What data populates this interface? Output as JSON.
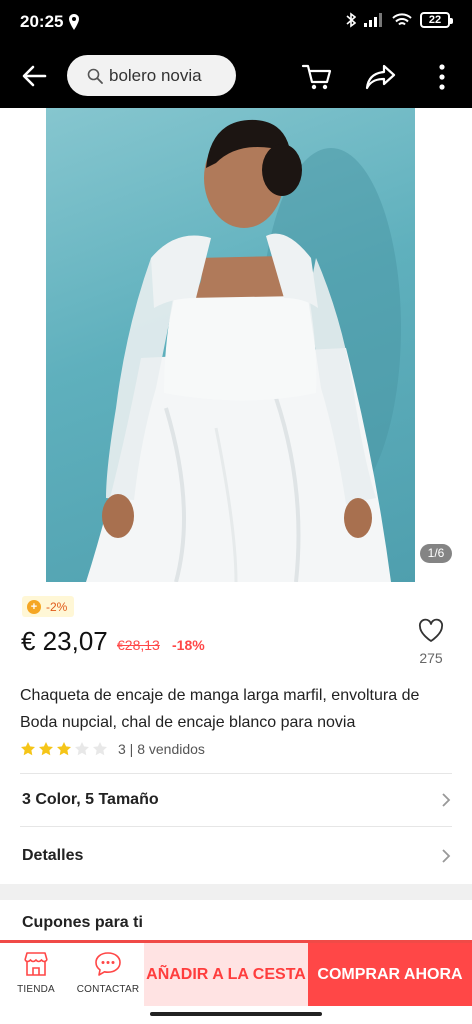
{
  "status_bar": {
    "time": "20:25",
    "battery": "22",
    "icons": [
      "location-icon",
      "bluetooth-icon",
      "signal-icon",
      "wifi-icon",
      "battery-icon"
    ]
  },
  "app_bar": {
    "search_text": "bolero novia",
    "icons": [
      "back-arrow-icon",
      "search-icon",
      "cart-icon",
      "share-icon",
      "more-vert-icon"
    ]
  },
  "gallery": {
    "counter": "1/6"
  },
  "product": {
    "coupon_badge": "-2%",
    "price": "€ 23,07",
    "old_price": "€28,13",
    "discount": "-18%",
    "wishlist_count": "275",
    "title": "Chaqueta de encaje de manga larga marfil, envoltura de Boda nupcial, chal de encaje blanco para novia",
    "rating": {
      "stars": 3,
      "max": 5
    },
    "rating_meta": "3 | 8 vendidos"
  },
  "sections": {
    "variants": "3 Color, 5 Tamaño",
    "details": "Detalles",
    "coupons": "Cupones para ti"
  },
  "bottom_bar": {
    "store_label": "TIENDA",
    "contact_label": "CONTACTAR",
    "add_to_cart": "AÑADIR A LA CESTA",
    "buy_now": "COMPRAR AHORA"
  },
  "colors": {
    "accent": "#ff4747",
    "accent_light": "#ffe3e3",
    "star": "#f5c518",
    "coupon_bg": "#fff7d6"
  }
}
